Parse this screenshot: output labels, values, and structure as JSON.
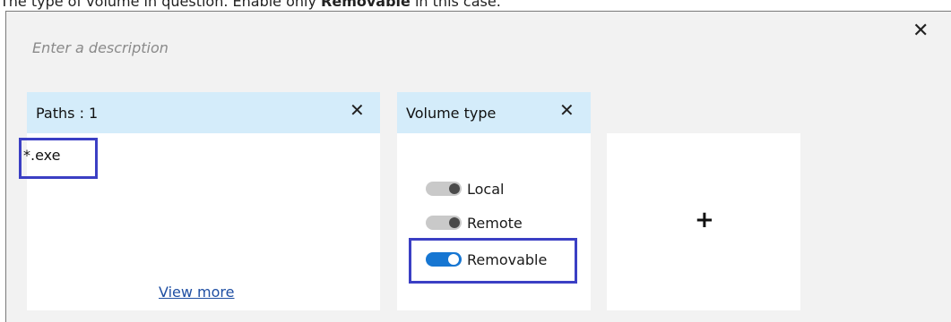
{
  "caption": {
    "text_before": "The type of volume in question. Enable only ",
    "bold": "Removable",
    "text_after": " in this case."
  },
  "panel": {
    "description_placeholder": "Enter a description",
    "close_icon": "close-icon",
    "close_glyph": "✕"
  },
  "paths_card": {
    "title": "Paths : 1",
    "close_glyph": "✕",
    "items": [
      "*.exe"
    ],
    "view_more": "View more"
  },
  "volume_type_card": {
    "title": "Volume type",
    "close_glyph": "✕",
    "options": [
      {
        "label": "Local",
        "enabled": false
      },
      {
        "label": "Remote",
        "enabled": false
      },
      {
        "label": "Removable",
        "enabled": true
      }
    ]
  },
  "add_card": {
    "plus_glyph": "+"
  },
  "colors": {
    "header_bg": "#d4ecfa",
    "highlight_border": "#3b3fc4",
    "toggle_on": "#1676d2",
    "link": "#1f4fa3"
  }
}
